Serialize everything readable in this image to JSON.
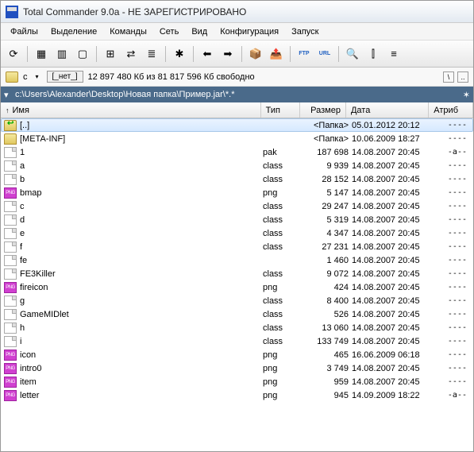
{
  "title": "Total Commander 9.0a - НЕ ЗАРЕГИСТРИРОВАНО",
  "menu": [
    "Файлы",
    "Выделение",
    "Команды",
    "Сеть",
    "Вид",
    "Конфигурация",
    "Запуск"
  ],
  "toolbar_icons": [
    "refresh-icon",
    "view-brief-icon",
    "view-full-icon",
    "thumbnails-icon",
    "tree-icon",
    "sync-icon",
    "compare-icon",
    "invert-icon",
    "back-icon",
    "forward-icon",
    "pack-icon",
    "unpack-icon",
    "ftp-icon",
    "url-icon",
    "search-icon",
    "multi-rename-icon",
    "notepad-icon"
  ],
  "toolbar_glyphs": [
    "⟳",
    "▦",
    "▥",
    "▢",
    "⊞",
    "⇄",
    "≣",
    "✱",
    "⬅",
    "➡",
    "📦",
    "📤",
    "FTP",
    "URL",
    "🔍",
    "⫿",
    "≡"
  ],
  "drive": {
    "letter": "c",
    "none_btn": "[_нет_]",
    "info": "12 897 480 Кб из 81 817 596 Кб свободно"
  },
  "path": "c:\\Users\\Alexander\\Desktop\\Новая папка\\Пример.jar\\*.*",
  "columns": {
    "name": "Имя",
    "type": "Тип",
    "size": "Размер",
    "date": "Дата",
    "attr": "Атриб"
  },
  "files": [
    {
      "icon": "up",
      "name": "[..]",
      "type": "",
      "size": "<Папка>",
      "date": "05.01.2012 20:12",
      "attr": "----",
      "sel": true
    },
    {
      "icon": "folder",
      "name": "[META-INF]",
      "type": "",
      "size": "<Папка>",
      "date": "10.06.2009 18:27",
      "attr": "----"
    },
    {
      "icon": "file",
      "name": "1",
      "type": "pak",
      "size": "187 698",
      "date": "14.08.2007 20:45",
      "attr": "-a--"
    },
    {
      "icon": "file",
      "name": "a",
      "type": "class",
      "size": "9 939",
      "date": "14.08.2007 20:45",
      "attr": "----"
    },
    {
      "icon": "file",
      "name": "b",
      "type": "class",
      "size": "28 152",
      "date": "14.08.2007 20:45",
      "attr": "----"
    },
    {
      "icon": "png",
      "name": "bmap",
      "type": "png",
      "size": "5 147",
      "date": "14.08.2007 20:45",
      "attr": "----"
    },
    {
      "icon": "file",
      "name": "c",
      "type": "class",
      "size": "29 247",
      "date": "14.08.2007 20:45",
      "attr": "----"
    },
    {
      "icon": "file",
      "name": "d",
      "type": "class",
      "size": "5 319",
      "date": "14.08.2007 20:45",
      "attr": "----"
    },
    {
      "icon": "file",
      "name": "e",
      "type": "class",
      "size": "4 347",
      "date": "14.08.2007 20:45",
      "attr": "----"
    },
    {
      "icon": "file",
      "name": "f",
      "type": "class",
      "size": "27 231",
      "date": "14.08.2007 20:45",
      "attr": "----"
    },
    {
      "icon": "file",
      "name": "fe",
      "type": "",
      "size": "1 460",
      "date": "14.08.2007 20:45",
      "attr": "----"
    },
    {
      "icon": "file",
      "name": "FE3Killer",
      "type": "class",
      "size": "9 072",
      "date": "14.08.2007 20:45",
      "attr": "----"
    },
    {
      "icon": "png",
      "name": "fireicon",
      "type": "png",
      "size": "424",
      "date": "14.08.2007 20:45",
      "attr": "----"
    },
    {
      "icon": "file",
      "name": "g",
      "type": "class",
      "size": "8 400",
      "date": "14.08.2007 20:45",
      "attr": "----"
    },
    {
      "icon": "file",
      "name": "GameMIDlet",
      "type": "class",
      "size": "526",
      "date": "14.08.2007 20:45",
      "attr": "----"
    },
    {
      "icon": "file",
      "name": "h",
      "type": "class",
      "size": "13 060",
      "date": "14.08.2007 20:45",
      "attr": "----"
    },
    {
      "icon": "file",
      "name": "i",
      "type": "class",
      "size": "133 749",
      "date": "14.08.2007 20:45",
      "attr": "----"
    },
    {
      "icon": "png",
      "name": "icon",
      "type": "png",
      "size": "465",
      "date": "16.06.2009 06:18",
      "attr": "----"
    },
    {
      "icon": "png",
      "name": "intro0",
      "type": "png",
      "size": "3 749",
      "date": "14.08.2007 20:45",
      "attr": "----"
    },
    {
      "icon": "png",
      "name": "item",
      "type": "png",
      "size": "959",
      "date": "14.08.2007 20:45",
      "attr": "----"
    },
    {
      "icon": "png",
      "name": "letter",
      "type": "png",
      "size": "945",
      "date": "14.09.2009 18:22",
      "attr": "-a--"
    }
  ]
}
